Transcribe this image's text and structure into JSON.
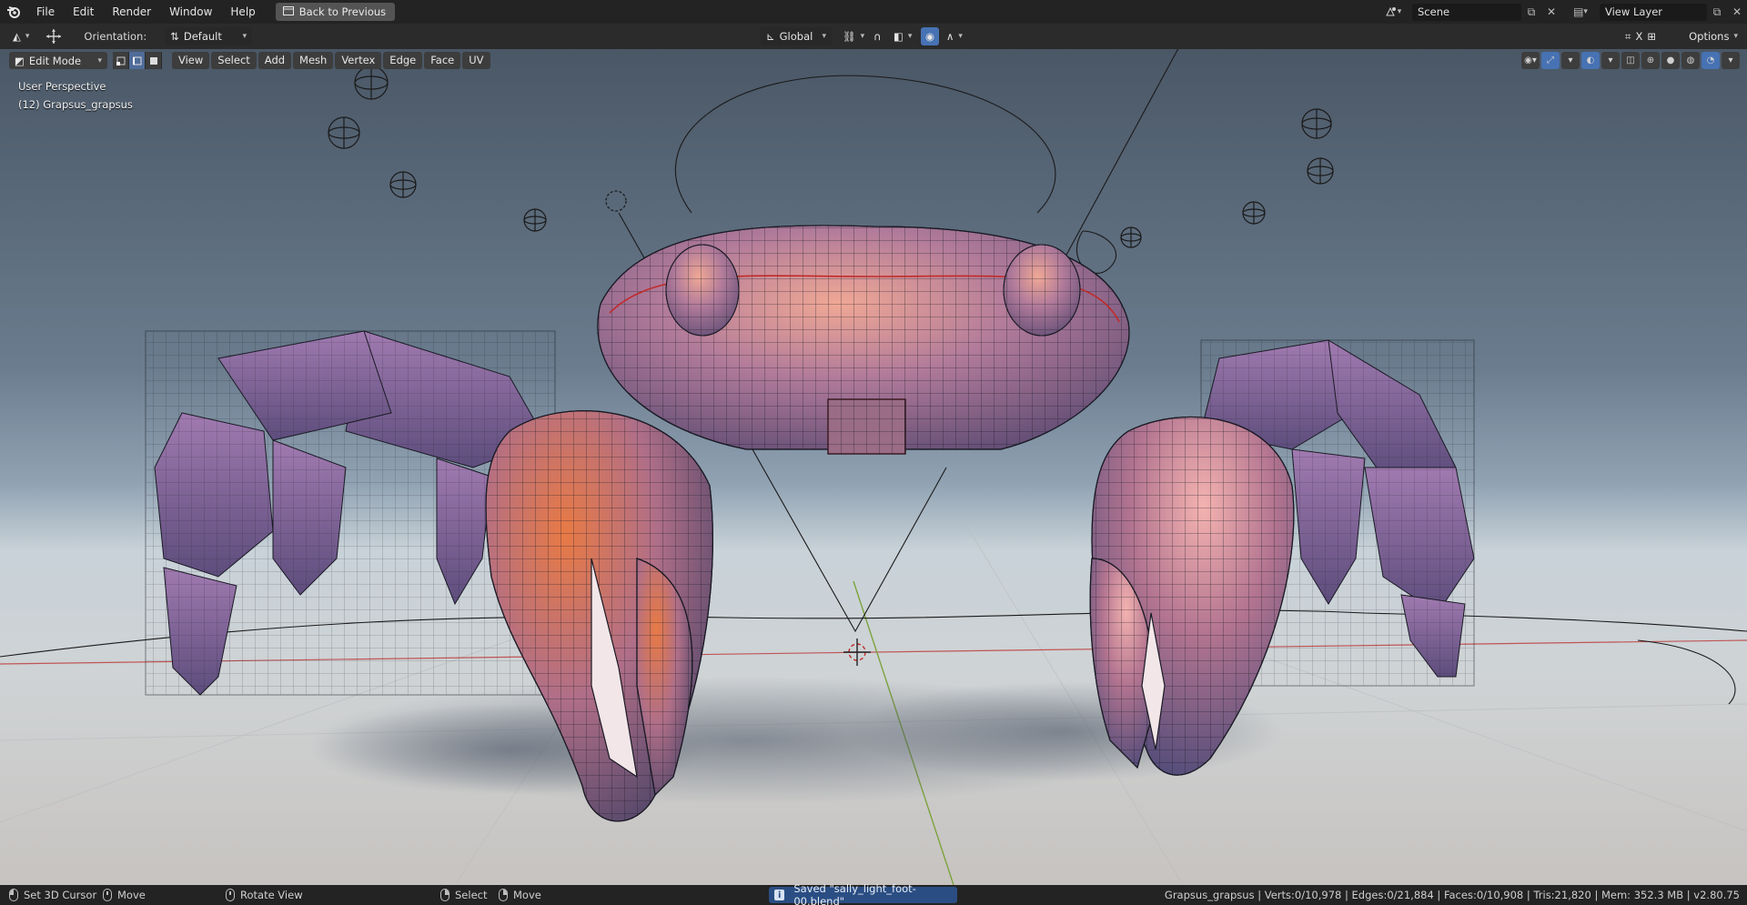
{
  "topbar": {
    "menus": [
      "File",
      "Edit",
      "Render",
      "Window",
      "Help"
    ],
    "back_button": "Back to Previous",
    "scene_name": "Scene",
    "view_layer": "View Layer"
  },
  "tool_header": {
    "orientation_label": "Orientation:",
    "orientation_value": "Default",
    "transform_orientation": "Global",
    "options_label": "Options"
  },
  "viewport_header": {
    "mode": "Edit Mode",
    "menus": [
      "View",
      "Select",
      "Add",
      "Mesh",
      "Vertex",
      "Edge",
      "Face",
      "UV"
    ]
  },
  "viewport": {
    "view_name": "User Perspective",
    "object_name": "(12) Grapsus_grapsus"
  },
  "statusbar": {
    "left_click_action": "Set 3D Cursor",
    "middle_click_action": "Move",
    "rotate_action": "Rotate View",
    "select_action": "Select",
    "move_action": "Move",
    "saved_message": "Saved \"sally_light_foot-00.blend\"",
    "stats": "Grapsus_grapsus | Verts:0/10,978 | Edges:0/21,884 | Faces:0/10,908 | Tris:21,820 | Mem: 352.3 MB | v2.80.75"
  },
  "colors": {
    "accent_blue": "#4772b3",
    "crab_shell": "#9a7ea8",
    "crab_orange": "#d3773f",
    "floor": "#cfd3d5"
  }
}
